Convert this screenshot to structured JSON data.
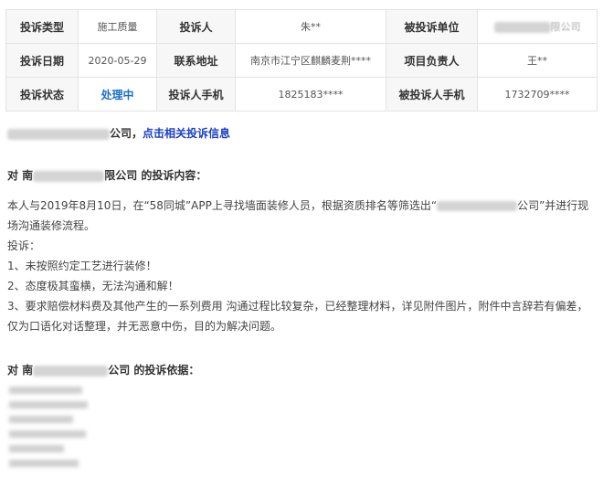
{
  "table": {
    "row1": {
      "label_type": "投诉类型",
      "value_type": "施工质量",
      "label_complainant": "投诉人",
      "value_complainant": "朱**",
      "label_target": "被投诉单位",
      "value_target_suffix": "限公司"
    },
    "row2": {
      "label_date": "投诉日期",
      "value_date": "2020-05-29",
      "label_address": "联系地址",
      "value_address": "南京市江宁区麒麟麦荆****",
      "label_manager": "项目负责人",
      "value_manager": "王**"
    },
    "row3": {
      "label_status": "投诉状态",
      "value_status": "处理中",
      "label_phone": "投诉人手机",
      "value_phone": "1825183****",
      "label_target_phone": "被投诉人手机",
      "value_target_phone": "1732709****"
    }
  },
  "company_line": {
    "suffix": "公司，",
    "link": "点击相关投诉信息"
  },
  "content_heading": {
    "prefix": "对 南",
    "suffix": "限公司 的投诉内容："
  },
  "content": {
    "p1_a": "本人与2019年8月10日，在“58同城”APP上寻找墙面装修人员，根据资质排名等筛选出“",
    "p1_b": "公司”并进行现场沟通装修流程。",
    "p2": "投诉：",
    "p3": "1、未按照约定工艺进行装修！",
    "p4": "2、态度极其蛮横，无法沟通和解！",
    "p5": "3、要求赔偿材料费及其他产生的一系列费用 沟通过程比较复杂，已经整理材料，详见附件图片，附件中言辞若有偏差，仅为口语化对话整理，并无恶意中伤，目的为解决问题。"
  },
  "basis_heading": {
    "prefix": "对 南",
    "suffix": "公司 的投诉依据："
  }
}
